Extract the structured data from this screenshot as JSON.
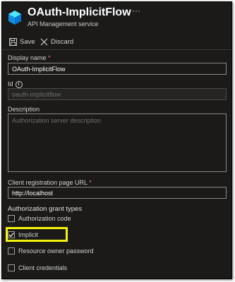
{
  "header": {
    "title": "OAuth-ImplicitFlow",
    "subtitle": "API Management service",
    "more": "···"
  },
  "toolbar": {
    "save_label": "Save",
    "discard_label": "Discard"
  },
  "form": {
    "display_name": {
      "label": "Display name",
      "required": "*",
      "value": "OAuth-ImplicitFlow"
    },
    "id": {
      "label": "Id",
      "value": "oauth-implicitflow"
    },
    "description": {
      "label": "Description",
      "placeholder": "Authorization server description"
    },
    "client_registration": {
      "label": "Client registration page URL",
      "required": "*",
      "value": "http://localhost"
    },
    "grant_types": {
      "title": "Authorization grant types",
      "options": [
        {
          "label": "Authorization code",
          "checked": false
        },
        {
          "label": "Implicit",
          "checked": true
        },
        {
          "label": "Resource owner password",
          "checked": false
        },
        {
          "label": "Client credentials",
          "checked": false
        }
      ]
    }
  },
  "colors": {
    "background": "#1b1a19",
    "highlight": "#f3f30a",
    "required": "#f1707b",
    "accent": "#00b7c3"
  },
  "icons": [
    "api-management-icon",
    "save-icon",
    "discard-icon",
    "info-icon",
    "checkmark-icon"
  ]
}
